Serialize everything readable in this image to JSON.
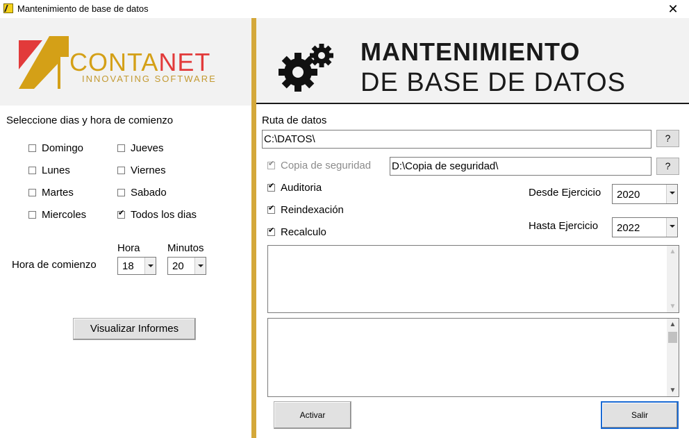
{
  "window": {
    "title": "Mantenimiento de base de datos",
    "close_glyph": "✕"
  },
  "logo": {
    "conta": "CONTA",
    "net": "NET",
    "tagline": "INNOVATING SOFTWARE",
    "colors": {
      "gold": "#d4a017",
      "red": "#e23a3a"
    }
  },
  "header": {
    "line1": "MANTENIMIENTO",
    "line2": "DE BASE DE DATOS"
  },
  "schedule": {
    "title": "Seleccione dias y hora de comienzo",
    "days": [
      {
        "label": "Domingo",
        "checked": false
      },
      {
        "label": "Lunes",
        "checked": false
      },
      {
        "label": "Martes",
        "checked": false
      },
      {
        "label": "Miercoles",
        "checked": false
      },
      {
        "label": "Jueves",
        "checked": false
      },
      {
        "label": "Viernes",
        "checked": false
      },
      {
        "label": "Sabado",
        "checked": false
      },
      {
        "label": "Todos los dias",
        "checked": true
      }
    ],
    "start_label": "Hora de comienzo",
    "hour_label": "Hora",
    "hour_value": "18",
    "minutes_label": "Minutos",
    "minutes_value": "20",
    "reports_button": "Visualizar Informes"
  },
  "form": {
    "data_path_label": "Ruta de datos",
    "data_path_value": "C:\\DATOS\\",
    "browse_label": "?",
    "backup_label": "Copia de seguridad",
    "backup_checked": true,
    "backup_path_value": "D:\\Copia de seguridad\\",
    "auditoria_label": "Auditoria",
    "auditoria_checked": true,
    "reindex_label": "Reindexación",
    "reindex_checked": true,
    "recalc_label": "Recalculo",
    "recalc_checked": true,
    "desde_label": "Desde Ejercicio",
    "desde_value": "2020",
    "hasta_label": "Hasta Ejercicio",
    "hasta_value": "2022"
  },
  "actions": {
    "activate": "Activar",
    "exit": "Salir"
  },
  "divider_color": "#d4a83a"
}
